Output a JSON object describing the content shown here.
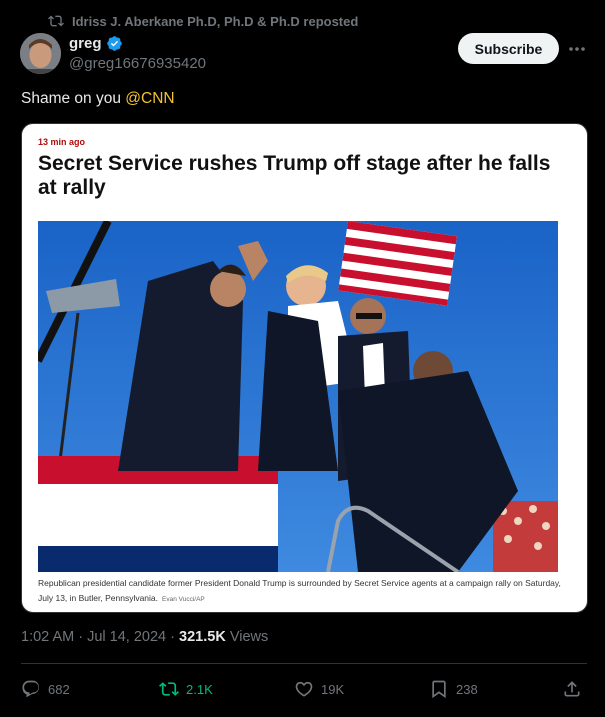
{
  "repost": {
    "text": "Idriss J. Aberkane Ph.D, Ph.D & Ph.D reposted"
  },
  "author": {
    "name": "greg",
    "handle": "@greg16676935420"
  },
  "header": {
    "subscribe_label": "Subscribe"
  },
  "tweet": {
    "text": "Shame on you ",
    "mention": "@CNN"
  },
  "card": {
    "time": "13 min ago",
    "headline": "Secret Service rushes Trump off stage after he falls at rally",
    "caption": "Republican presidential candidate former President Donald Trump is surrounded by Secret Service agents at a campaign rally on Saturday, July 13, in Butler, Pennsylvania.",
    "credit": "Evan Vucci/AP"
  },
  "meta": {
    "time": "1:02 AM",
    "separator": "·",
    "date": "Jul 14, 2024",
    "views_count": "321.5K",
    "views_label": "Views"
  },
  "actions": {
    "replies": "682",
    "reposts": "2.1K",
    "likes": "19K",
    "bookmarks": "238"
  },
  "colors": {
    "accent_repost": "#00ba7c",
    "mention": "#f4c430",
    "verified": "#1d9bf0",
    "headline_time": "#b10b0b"
  }
}
